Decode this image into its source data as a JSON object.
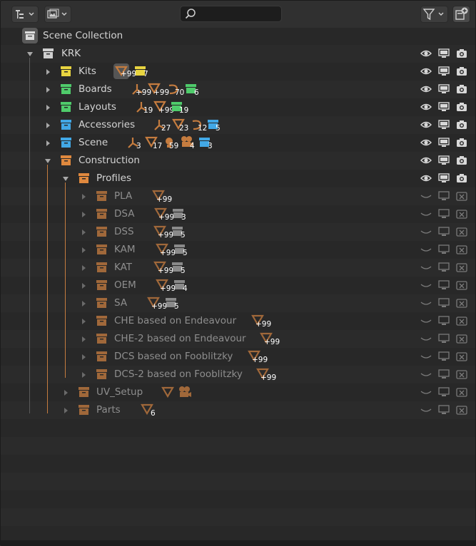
{
  "header": {
    "display_mode_icon": "outliner-display-icon",
    "filter_mode_icon": "data-filter-icon",
    "search_placeholder": "",
    "filter_icon": "funnel-icon",
    "new_collection_icon": "new-collection-icon"
  },
  "colors": {
    "kits": "#e8d440",
    "boards": "#4fcc6b",
    "layouts": "#4fcc6b",
    "accessories": "#42a8e6",
    "scene": "#42a8e6",
    "construction": "#e0893e",
    "orange_icon": "#c57c3f",
    "blue_icon": "#42a8e6",
    "green_icon": "#4fcc6b",
    "yellow_icon": "#e8d440",
    "gray_icon": "#9a9a9a"
  },
  "tree": {
    "root": "Scene Collection",
    "krk": "KRK",
    "kits": {
      "label": "Kits",
      "c1": "+99",
      "c2": "7"
    },
    "boards": {
      "label": "Boards",
      "c1": "+99",
      "c2": "+99",
      "c3": "70",
      "c4": "6"
    },
    "layouts": {
      "label": "Layouts",
      "c1": "19",
      "c2": "+99",
      "c3": "19"
    },
    "accessories": {
      "label": "Accessories",
      "c1": "27",
      "c2": "23",
      "c3": "12",
      "c4": "5"
    },
    "scene": {
      "label": "Scene",
      "c1": "3",
      "c2": "17",
      "c3": "59",
      "c4": "4",
      "c5": "3"
    },
    "construction": {
      "label": "Construction"
    },
    "profiles": {
      "label": "Profiles"
    },
    "pla": {
      "label": "PLA",
      "c1": "+99"
    },
    "dsa": {
      "label": "DSA",
      "c1": "+99",
      "c2": "3"
    },
    "dss": {
      "label": "DSS",
      "c1": "+99",
      "c2": "5"
    },
    "kam": {
      "label": "KAM",
      "c1": "+99",
      "c2": "5"
    },
    "kat": {
      "label": "KAT",
      "c1": "+99",
      "c2": "5"
    },
    "oem": {
      "label": "OEM",
      "c1": "+99",
      "c2": "4"
    },
    "sa": {
      "label": "SA",
      "c1": "+99",
      "c2": "5"
    },
    "che": {
      "label": "CHE based on Endeavour",
      "c1": "+99"
    },
    "che2": {
      "label": "CHE-2 based on Endeavour",
      "c1": "+99"
    },
    "dcs": {
      "label": "DCS based on Fooblitzky",
      "c1": "+99"
    },
    "dcs2": {
      "label": "DCS-2 based on Fooblitzky",
      "c1": "+99"
    },
    "uvsetup": {
      "label": "UV_Setup"
    },
    "parts": {
      "label": "Parts",
      "c1": "6"
    }
  }
}
